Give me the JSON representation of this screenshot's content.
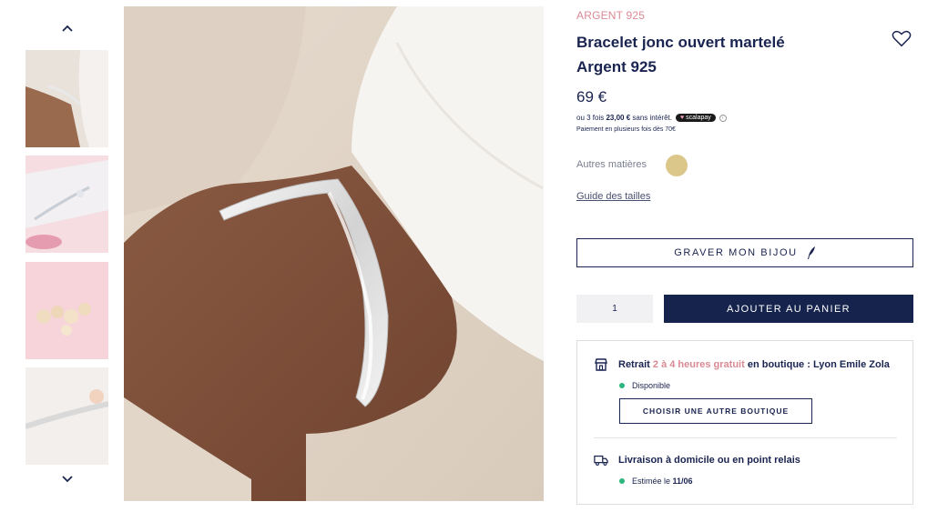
{
  "thumbnails": {
    "prev_icon": "chevron-up-icon",
    "next_icon": "chevron-down-icon",
    "items": [
      "thumb-1",
      "thumb-2",
      "thumb-3",
      "thumb-4"
    ]
  },
  "product": {
    "brand": "ARGENT 925",
    "title": "Bracelet jonc ouvert martelé Argent 925",
    "price": "69 €",
    "installments": {
      "prefix": "ou 3 fois ",
      "amount": "23,00 €",
      "suffix": " sans intérêt.",
      "provider": "scalapay"
    },
    "payment_note": "Paiement en plusieurs fois dès 70€",
    "materials_label": "Autres matières",
    "swatch_color": "#dcc78b",
    "size_guide": "Guide des tailles"
  },
  "actions": {
    "engrave_label": "GRAVER MON BIJOU",
    "quantity": "1",
    "add_to_cart_label": "AJOUTER AU PANIER"
  },
  "delivery": {
    "pickup": {
      "title_prefix": "Retrait ",
      "title_accent": "2 à 4 heures gratuit",
      "title_suffix": " en boutique : Lyon Emile Zola",
      "status": "Disponible",
      "choose_store_label": "CHOISIR UNE AUTRE BOUTIQUE"
    },
    "home": {
      "title": "Livraison à domicile ou en point relais",
      "status_prefix": "Estimée le ",
      "status_date": "11/06"
    }
  },
  "colors": {
    "brand_pink": "#d98a94",
    "navy": "#15234d",
    "available_green": "#2cb67d"
  }
}
